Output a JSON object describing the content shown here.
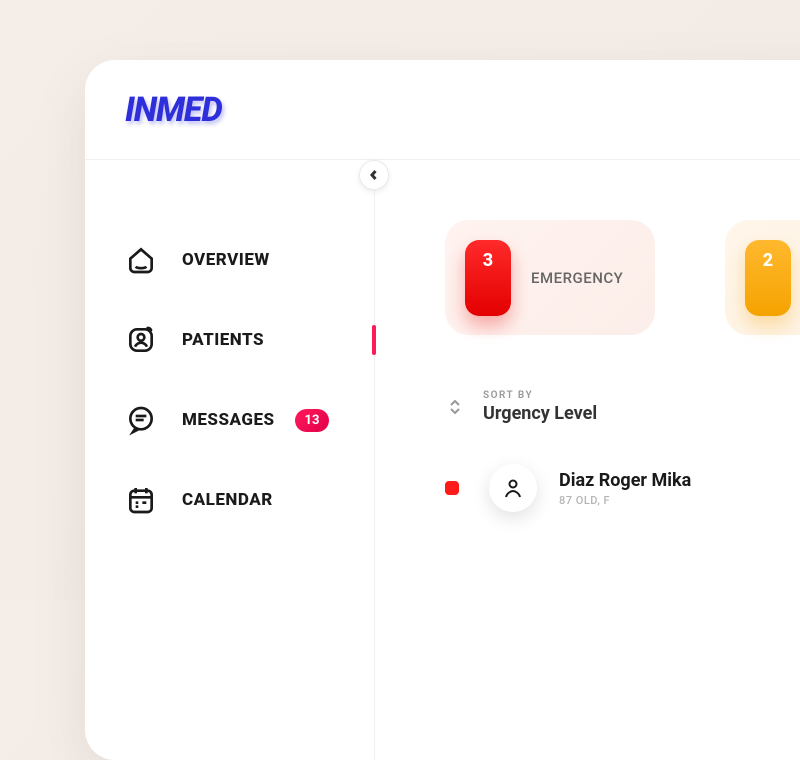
{
  "brand": "INMED",
  "sidebar": {
    "items": [
      {
        "label": "OVERVIEW"
      },
      {
        "label": "PATIENTS"
      },
      {
        "label": "MESSAGES",
        "badge": "13"
      },
      {
        "label": "CALENDAR"
      }
    ]
  },
  "cards": [
    {
      "count": "3",
      "label": "EMERGENCY"
    },
    {
      "count": "2",
      "label": ""
    }
  ],
  "sort": {
    "caption": "SORT BY",
    "value": "Urgency Level"
  },
  "patients": [
    {
      "name": "Diaz Roger Mika",
      "meta": "87 OLD, F"
    }
  ]
}
